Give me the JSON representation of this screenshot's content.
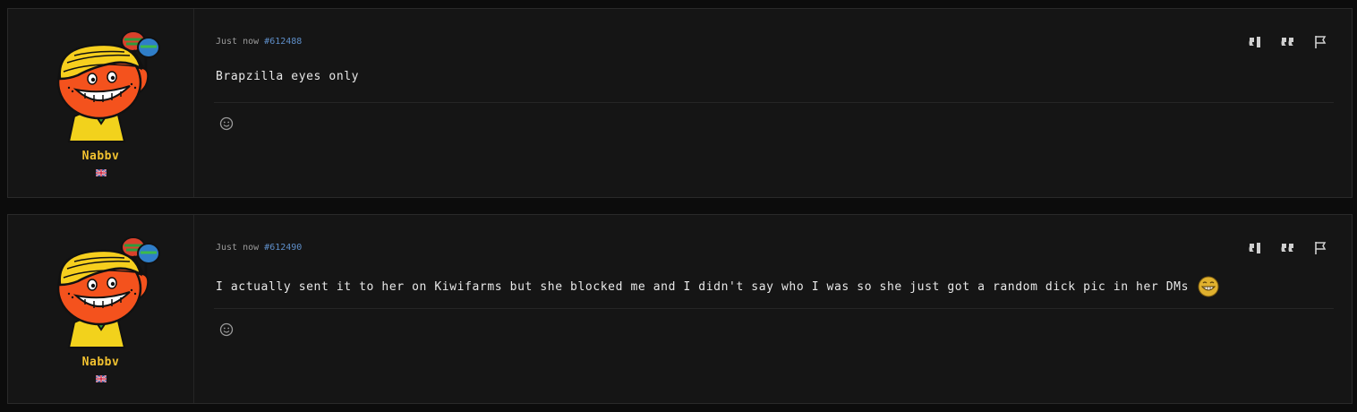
{
  "posts": [
    {
      "username": "Nabbv",
      "time": "Just now",
      "post_number": "#612488",
      "message": "Brapzilla eyes only",
      "flag_icon": "uk-flag-icon",
      "has_emoji": false
    },
    {
      "username": "Nabbv",
      "time": "Just now",
      "post_number": "#612490",
      "message": "I actually sent it to her on Kiwifarms but she blocked me and I didn't say who I was so she just got a random dick pic in her DMs",
      "flag_icon": "uk-flag-icon",
      "has_emoji": true,
      "emoji_icon": "grin-emoji-icon"
    }
  ],
  "colors": {
    "username": "#f2c230",
    "post_number": "#5e8ec8",
    "panel_bg": "#151515",
    "page_bg": "#0c0c0c"
  }
}
